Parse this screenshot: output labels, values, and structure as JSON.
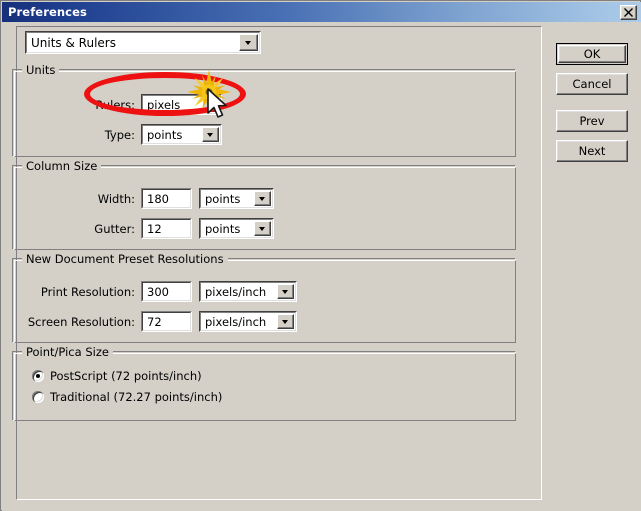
{
  "window": {
    "title": "Preferences",
    "close_icon": "close-icon"
  },
  "category": {
    "selected": "Units & Rulers",
    "arrow_icon": "chevron-down-icon"
  },
  "groups": {
    "units": {
      "title": "Units",
      "rows": [
        {
          "label": "Rulers:",
          "value": "pixels"
        },
        {
          "label": "Type:",
          "value": "points"
        }
      ]
    },
    "column_size": {
      "title": "Column Size",
      "rows": [
        {
          "label": "Width:",
          "value": "180",
          "unit": "points"
        },
        {
          "label": "Gutter:",
          "value": "12",
          "unit": "points"
        }
      ]
    },
    "resolutions": {
      "title": "New Document Preset Resolutions",
      "rows": [
        {
          "label": "Print Resolution:",
          "value": "300",
          "unit": "pixels/inch"
        },
        {
          "label": "Screen Resolution:",
          "value": "72",
          "unit": "pixels/inch"
        }
      ]
    },
    "point_pica": {
      "title": "Point/Pica Size",
      "options": [
        {
          "label": "PostScript (72 points/inch)",
          "selected": true
        },
        {
          "label": "Traditional (72.27 points/inch)",
          "selected": false
        }
      ]
    }
  },
  "buttons": {
    "ok": "OK",
    "cancel": "Cancel",
    "prev": "Prev",
    "next": "Next"
  },
  "annotations": {
    "highlight_color": "#ee1111",
    "starburst_color": "#f5c518",
    "cursor_icon": "mouse-pointer-icon",
    "starburst_icon": "click-burst-icon",
    "highlight_icon": "red-ellipse-highlight"
  }
}
